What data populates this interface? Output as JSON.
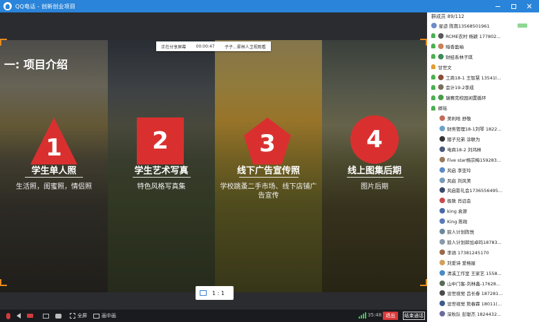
{
  "window": {
    "title": "QQ电话 - 创新创业项目"
  },
  "share_bar": {
    "status": "正在分享屏幕",
    "time": "00:00:47",
    "presenter": "子子...翠林人卫视观看"
  },
  "slide": {
    "section_title": "一: 项目介绍",
    "items": [
      {
        "number": "1",
        "title": "学生单人照",
        "desc": [
          "生活照，闺蜜照，情侣照"
        ]
      },
      {
        "number": "2",
        "title": "学生艺术写真",
        "desc": [
          "特色风格写真集"
        ]
      },
      {
        "number": "3",
        "title": "线下广告宣传照",
        "desc": [
          "学校跳蚤二手市场、线下店铺广",
          "告宣传"
        ]
      },
      {
        "number": "4",
        "title": "线上图集后期",
        "desc": [
          "图片后期"
        ]
      }
    ]
  },
  "ratio": {
    "label": "1 : 1"
  },
  "toolbar": {
    "fullscreen": "全屏",
    "pip": "画中画",
    "timer": "35:48",
    "exit": "退出",
    "end": "结束通话"
  },
  "members": {
    "header": "群成员 89/112",
    "list": [
      {
        "name": "星迹 陈南13568501961",
        "type": "avatar",
        "color": "#6b8cc7"
      },
      {
        "name": "RCME农村 杨颖 177802...",
        "type": "green",
        "color": "#5a5a5a"
      },
      {
        "name": "暗香盈袖",
        "type": "green",
        "color": "#c87f5a"
      },
      {
        "name": "财经系林子琪",
        "type": "green",
        "color": "#3c8a5a"
      },
      {
        "name": "甘世文",
        "type": "orange",
        "color": ""
      },
      {
        "name": "工商18-1 王智慧 13541l...",
        "type": "green",
        "color": "#8a4d3a"
      },
      {
        "name": "会计19-2李成",
        "type": "green",
        "color": "#7a6f5a"
      },
      {
        "name": "瑞赛克校园闲置循环",
        "type": "green",
        "color": "#4a9a4a"
      },
      {
        "name": "卿瑶",
        "type": "green",
        "color": ""
      },
      {
        "name": "美利哈 舒敬",
        "type": "avatar",
        "color": "#c46a5a"
      },
      {
        "name": "财务管理18-1刘琴 1822...",
        "type": "avatar",
        "color": "#6aa0c8"
      },
      {
        "name": "猪子兄弟 涂联为",
        "type": "avatar",
        "color": "#333333"
      },
      {
        "name": "电商18-2 刘鸿林",
        "type": "avatar",
        "color": "#4a5a7a"
      },
      {
        "name": "Five  star杨宗梅159283...",
        "type": "avatar",
        "color": "#9a7a5a"
      },
      {
        "name": "风启  李亚玲",
        "type": "avatar",
        "color": "#5a8ac8"
      },
      {
        "name": "风启  刘风美",
        "type": "avatar",
        "color": "#7a9ab8"
      },
      {
        "name": "风启影礼会17365564​95...",
        "type": "avatar",
        "color": "#3a4a6a"
      },
      {
        "name": "极致 肖远会",
        "type": "avatar",
        "color": "#c84a4a"
      },
      {
        "name": "king 袁源",
        "type": "avatar",
        "color": "#4a6aa8"
      },
      {
        "name": "King 陈政",
        "type": "avatar",
        "color": "#5a7ab8"
      },
      {
        "name": "狼人计划陈悦",
        "type": "avatar",
        "color": "#6a8a9a"
      },
      {
        "name": "狼人计划郎加卓玛18783...",
        "type": "avatar",
        "color": "#8a9aaa"
      },
      {
        "name": "李涵 17381245170",
        "type": "avatar",
        "color": "#9a6a4a"
      },
      {
        "name": "刘爱诗  爱格屋",
        "type": "avatar",
        "color": "#d2a05a"
      },
      {
        "name": "清溪工作室 王家艺 1558...",
        "type": "avatar",
        "color": "#4a8ac8"
      },
      {
        "name": "山中门客-刘林鑫-17628...",
        "type": "avatar",
        "color": "#5a6a5a"
      },
      {
        "name": "设世视觉 吕长春 187281...",
        "type": "avatar",
        "color": "#4a4a4a"
      },
      {
        "name": "设世视觉 熊春霖 18011(...",
        "type": "avatar",
        "color": "#3a5a8a"
      },
      {
        "name": "深秋队  彭聪杰 1824432...",
        "type": "avatar",
        "color": "#6a6a9a"
      }
    ]
  }
}
